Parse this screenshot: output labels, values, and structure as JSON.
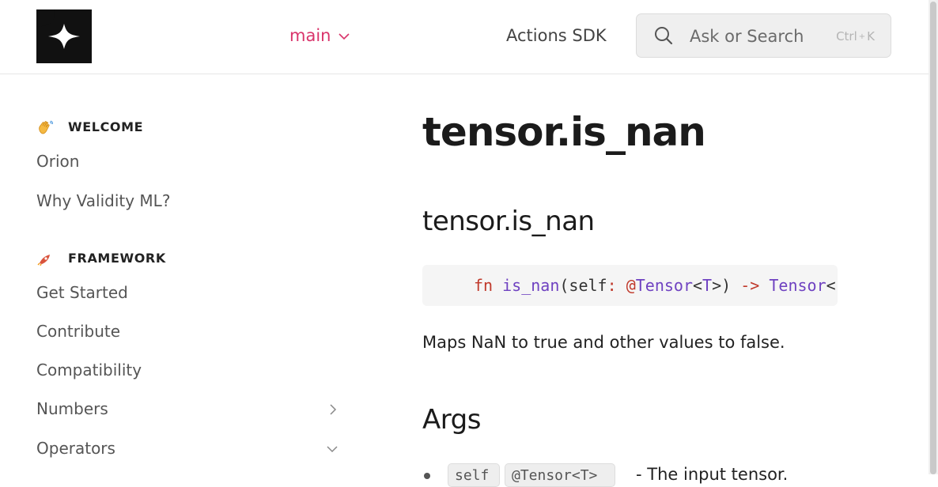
{
  "header": {
    "logo_name": "sparkle-logo",
    "version": "main",
    "actions_link": "Actions SDK",
    "search": {
      "placeholder": "Ask or Search",
      "shortcut_key": "Ctrl",
      "shortcut_plus": "+",
      "shortcut_letter": "K"
    }
  },
  "sidebar": {
    "sections": [
      {
        "title": "WELCOME",
        "icon": "waving-hand-icon",
        "items": [
          {
            "label": "Orion"
          },
          {
            "label": "Why Validity ML?"
          }
        ]
      },
      {
        "title": "FRAMEWORK",
        "icon": "rocket-icon",
        "items": [
          {
            "label": "Get Started"
          },
          {
            "label": "Contribute"
          },
          {
            "label": "Compatibility"
          },
          {
            "label": "Numbers",
            "chevron": "right"
          },
          {
            "label": "Operators",
            "chevron": "down"
          }
        ]
      }
    ]
  },
  "main": {
    "title": "tensor.is_nan",
    "subtitle": "tensor.is_nan",
    "code": {
      "kw": "fn",
      "fn": "is_nan",
      "open": "(self",
      "colon": ":",
      "at": "@",
      "type1": "Tensor",
      "lt": "<",
      "generic": "T",
      "close": ">)",
      "arrow": "->",
      "type2": "Tensor",
      "tail": "<"
    },
    "description": "Maps NaN to true and other values to false.",
    "args_heading": "Args",
    "args": [
      {
        "code1": "self",
        "code2": "@Tensor<T>",
        "text": "- The input tensor."
      }
    ]
  },
  "colors": {
    "accent": "#d9346b",
    "keyword": "#c0392b",
    "type": "#6f42c1"
  }
}
